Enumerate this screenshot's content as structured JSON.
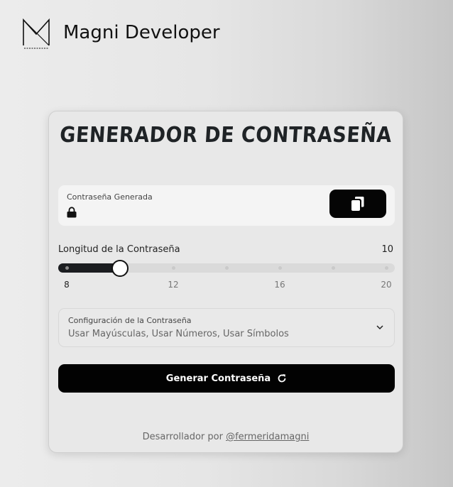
{
  "brand": {
    "name": "Magni Developer",
    "logo_icon": "magni-m-logo-icon"
  },
  "card": {
    "title": "GENERADOR DE CONTRASEÑA",
    "password": {
      "label": "Contraseña Generada",
      "value": "",
      "lock_icon": "lock-icon",
      "copy_icon": "copy-icon"
    },
    "length": {
      "label": "Longitud de la Contraseña",
      "value": "10",
      "min": 8,
      "max": 20,
      "current": 10,
      "ticks": [
        "8",
        "12",
        "16",
        "20"
      ]
    },
    "config": {
      "label": "Configuración de la Contraseña",
      "value": "Usar Mayúsculas, Usar Números, Usar Símbolos",
      "chevron_icon": "chevron-down-icon"
    },
    "generate_label": "Generar Contraseña",
    "refresh_icon": "refresh-icon",
    "footer": {
      "prefix": "Desarrollador por",
      "link": "@fermeridamagni"
    }
  },
  "colors": {
    "accent": "#050505",
    "card": "#e8e8e8"
  }
}
